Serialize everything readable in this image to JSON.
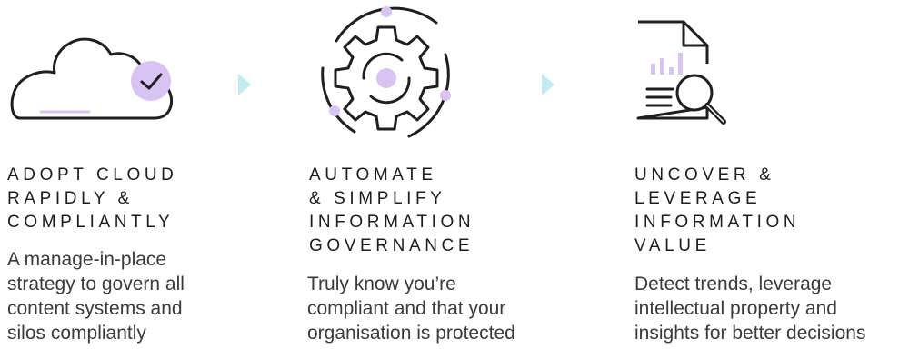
{
  "colors": {
    "accent_purple": "#d9c3f3",
    "accent_teal": "#c2ecf2",
    "stroke": "#1f1f1f"
  },
  "steps": [
    {
      "icon": "cloud-check-icon",
      "heading_lines": [
        "ADOPT CLOUD",
        "RAPIDLY &",
        "COMPLIANTLY"
      ],
      "desc_lines": [
        "A manage-in-place",
        "strategy to govern all",
        "content systems and",
        "silos compliantly"
      ]
    },
    {
      "icon": "gear-icon",
      "heading_lines": [
        "AUTOMATE",
        "& SIMPLIFY",
        "INFORMATION",
        "GOVERNANCE"
      ],
      "desc_lines": [
        "Truly know you’re",
        "compliant and that your",
        "organisation is protected"
      ]
    },
    {
      "icon": "document-search-icon",
      "heading_lines": [
        "UNCOVER &",
        "LEVERAGE",
        "INFORMATION",
        "VALUE"
      ],
      "desc_lines": [
        "Detect trends, leverage",
        "intellectual property and",
        "insights for better decisions"
      ]
    }
  ],
  "arrows": [
    "arrow-icon",
    "arrow-icon"
  ]
}
